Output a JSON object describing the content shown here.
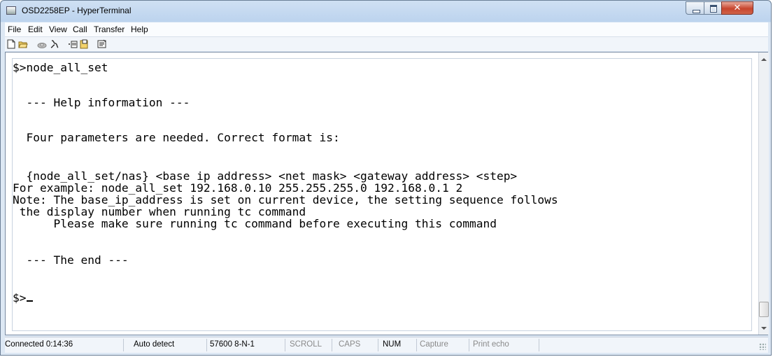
{
  "window": {
    "title": "OSD2258EP - HyperTerminal"
  },
  "menu": [
    "File",
    "Edit",
    "View",
    "Call",
    "Transfer",
    "Help"
  ],
  "toolbar": {
    "icons": [
      "new-document-icon",
      "open-folder-icon",
      "phone-icon",
      "disconnect-icon",
      "send-icon",
      "receive-icon",
      "properties-icon"
    ]
  },
  "terminal": {
    "lines": [
      "$>node_all_set",
      "",
      "  --- Help information ---",
      "",
      "  Four parameters are needed. Correct format is:",
      "",
      "  {node_all_set/nas} <base ip address> <net mask> <gateway address> <step>",
      "For example: node_all_set 192.168.0.10 255.255.255.0 192.168.0.1 2",
      "Note: The base_ip_address is set on current device, the setting sequence follows",
      " the display number when running tc command",
      "      Please make sure running tc command before executing this command",
      "",
      "  --- The end ---",
      "",
      "$>"
    ]
  },
  "status": {
    "connected": "Connected 0:14:36",
    "detect": "Auto detect",
    "baud": "57600 8-N-1",
    "scroll": "SCROLL",
    "caps": "CAPS",
    "num": "NUM",
    "capture": "Capture",
    "print_echo": "Print echo"
  },
  "colors": {
    "titlebar": "#bcd3ee",
    "close_button": "#c7452d",
    "terminal_bg": "#ffffff"
  }
}
